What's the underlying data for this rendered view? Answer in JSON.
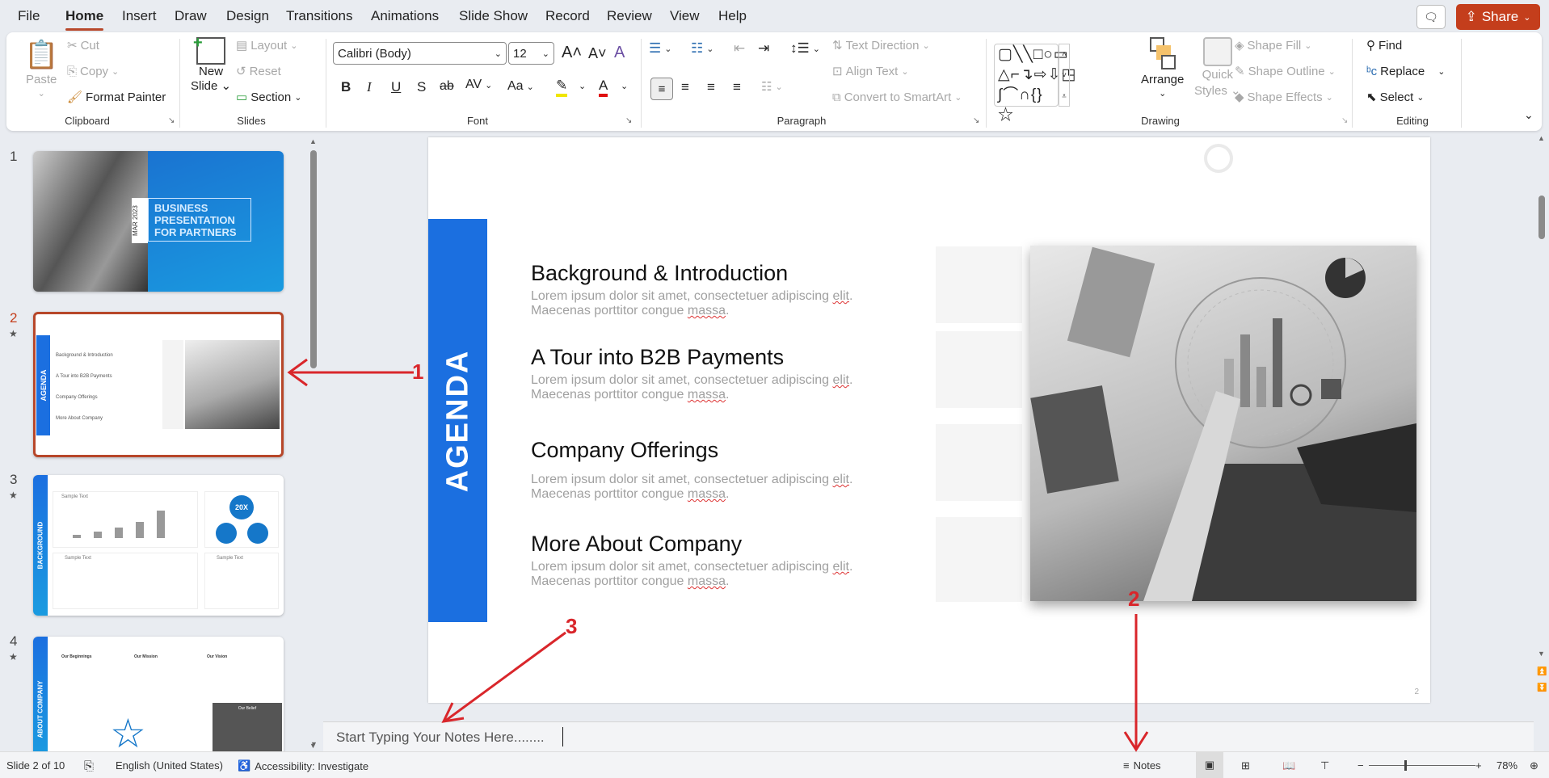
{
  "menu": {
    "tabs": [
      "File",
      "Home",
      "Insert",
      "Draw",
      "Design",
      "Transitions",
      "Animations",
      "Slide Show",
      "Record",
      "Review",
      "View",
      "Help"
    ],
    "active": "Home",
    "share_label": "Share"
  },
  "ribbon": {
    "clipboard": {
      "label": "Clipboard",
      "paste": "Paste",
      "cut": "Cut",
      "copy": "Copy",
      "format_painter": "Format Painter"
    },
    "slides": {
      "label": "Slides",
      "new_slide_1": "New",
      "new_slide_2": "Slide",
      "layout": "Layout",
      "reset": "Reset",
      "section": "Section"
    },
    "font": {
      "label": "Font",
      "font_name": "Calibri (Body)",
      "font_size": "12",
      "change_case": "Aa"
    },
    "paragraph": {
      "label": "Paragraph",
      "text_direction": "Text Direction",
      "align_text": "Align Text",
      "convert_smartart": "Convert to SmartArt"
    },
    "drawing": {
      "label": "Drawing",
      "arrange": "Arrange",
      "quick_styles_1": "Quick",
      "quick_styles_2": "Styles",
      "shape_fill": "Shape Fill",
      "shape_outline": "Shape Outline",
      "shape_effects": "Shape Effects"
    },
    "editing": {
      "label": "Editing",
      "find": "Find",
      "replace": "Replace",
      "select": "Select"
    }
  },
  "thumbnails": [
    {
      "number": "1",
      "title_lines": [
        "BUSINESS",
        "PRESENTATION",
        "FOR PARTNERS"
      ],
      "date": "MAR 2023"
    },
    {
      "number": "2",
      "selected": true,
      "title": "AGENDA",
      "items": [
        "Background & Introduction",
        "A Tour into B2B Payments",
        "Company Offerings",
        "More About Company"
      ]
    },
    {
      "number": "3",
      "title": "BACKGROUND",
      "sample": "Sample Text",
      "badge": "20X"
    },
    {
      "number": "4",
      "title": "ABOUT COMPANY",
      "cards": [
        "Our Beginnings",
        "Our Mission",
        "Our Vision"
      ],
      "belief": "Our Belief"
    }
  ],
  "slide": {
    "title": "AGENDA",
    "items": [
      {
        "heading": "Background & Introduction",
        "line1a": "Lorem ipsum dolor sit amet, consectetuer adipiscing ",
        "line1b": "elit",
        "line1c": ".",
        "line2a": "Maecenas porttitor congue ",
        "line2b": "massa",
        "line2c": "."
      },
      {
        "heading": "A Tour into B2B Payments",
        "line1a": "Lorem ipsum dolor sit amet, consectetuer adipiscing ",
        "line1b": "elit",
        "line1c": ".",
        "line2a": "Maecenas porttitor congue ",
        "line2b": "massa",
        "line2c": "."
      },
      {
        "heading": "Company Offerings",
        "line1a": "Lorem ipsum dolor sit amet, consectetuer adipiscing ",
        "line1b": "elit",
        "line1c": ".",
        "line2a": "Maecenas porttitor congue ",
        "line2b": "massa",
        "line2c": "."
      },
      {
        "heading": "More About Company",
        "line1a": "Lorem ipsum dolor sit amet, consectetuer adipiscing ",
        "line1b": "elit",
        "line1c": ".",
        "line2a": "Maecenas porttitor congue ",
        "line2b": "massa",
        "line2c": "."
      }
    ],
    "page_number": "2",
    "accent": "#1b6fe0"
  },
  "notes": {
    "text": "Start Typing Your Notes Here........"
  },
  "annotations": {
    "a1": "1",
    "a2": "2",
    "a3": "3",
    "color": "#d9262b"
  },
  "status": {
    "slide_of": "Slide 2 of 10",
    "language": "English (United States)",
    "accessibility": "Accessibility: Investigate",
    "notes": "Notes",
    "zoom": "78%"
  }
}
